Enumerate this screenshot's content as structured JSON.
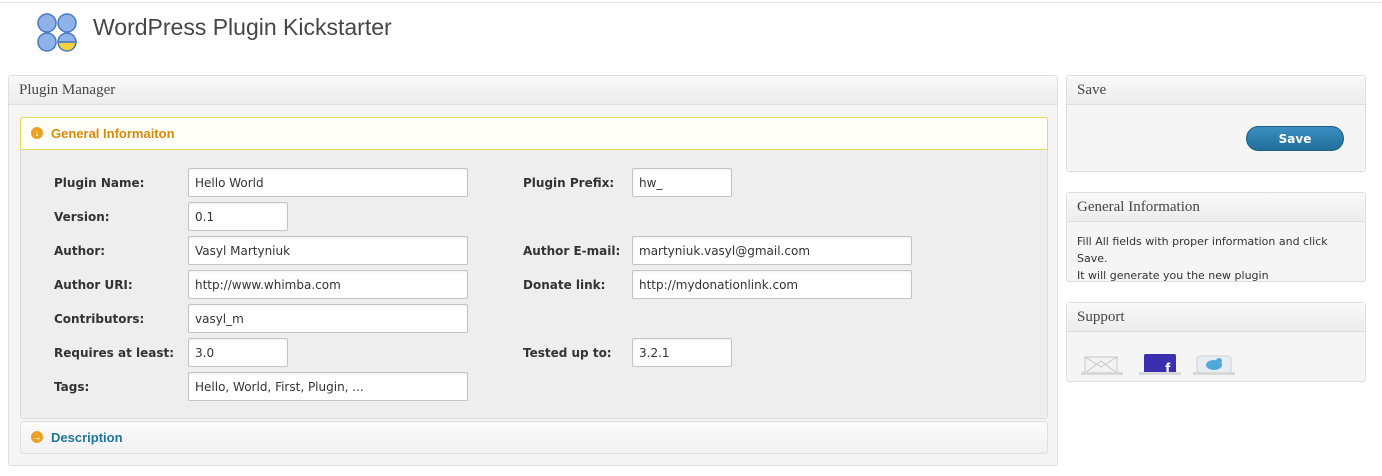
{
  "header": {
    "title": "WordPress Plugin Kickstarter"
  },
  "main": {
    "box_title": "Plugin Manager",
    "sections": {
      "general_title": "General Informaiton",
      "description_title": "Description"
    },
    "fields": {
      "plugin_name": {
        "label": "Plugin Name:",
        "value": "Hello World"
      },
      "plugin_prefix": {
        "label": "Plugin Prefix:",
        "value": "hw_"
      },
      "version": {
        "label": "Version:",
        "value": "0.1"
      },
      "author": {
        "label": "Author:",
        "value": "Vasyl Martyniuk"
      },
      "author_email": {
        "label": "Author E-mail:",
        "value": "martyniuk.vasyl@gmail.com"
      },
      "author_uri": {
        "label": "Author URI:",
        "value": "http://www.whimba.com"
      },
      "donate_link": {
        "label": "Donate link:",
        "value": "http://mydonationlink.com"
      },
      "contributors": {
        "label": "Contributors:",
        "value": "vasyl_m"
      },
      "requires": {
        "label": "Requires at least:",
        "value": "3.0"
      },
      "tested": {
        "label": "Tested up to:",
        "value": "3.2.1"
      },
      "tags": {
        "label": "Tags:",
        "value": "Hello, World, First, Plugin, ..."
      }
    }
  },
  "sidebar": {
    "save": {
      "title": "Save",
      "button_label": "Save"
    },
    "info": {
      "title": "General Information",
      "line1": "Fill All fields with proper information and click Save.",
      "line2": "It will generate you the new plugin"
    },
    "support": {
      "title": "Support",
      "icons": [
        "email-icon",
        "facebook-icon",
        "twitter-icon"
      ]
    }
  },
  "colors": {
    "accent_orange": "#e9a227",
    "section_title_orange": "#d78a0a",
    "link_blue": "#21759b",
    "save_button": "#216f9b"
  }
}
